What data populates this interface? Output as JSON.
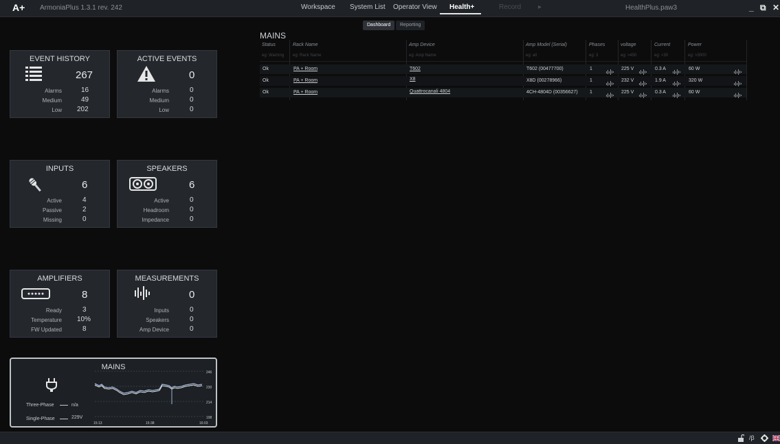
{
  "titlebar": {
    "logo": "A+",
    "app_version": "ArmoniaPlus 1.3.1 rev. 242",
    "menu": [
      "Workspace",
      "System List",
      "Operator View",
      "Health+",
      "Record"
    ],
    "file": "HealthPlus.paw3",
    "window_buttons": [
      "_",
      "⧉",
      "✕"
    ]
  },
  "subtabs": {
    "dashboard": "Dashboard",
    "reporting": "Reporting"
  },
  "cards": {
    "event_history": {
      "title": "EVENT HISTORY",
      "value": "267",
      "icon": "list-icon",
      "rows": [
        {
          "label": "Alarms",
          "value": "16"
        },
        {
          "label": "Medium",
          "value": "49"
        },
        {
          "label": "Low",
          "value": "202"
        }
      ]
    },
    "active_events": {
      "title": "ACTIVE EVENTS",
      "value": "0",
      "icon": "warning-icon",
      "rows": [
        {
          "label": "Alarms",
          "value": "0"
        },
        {
          "label": "Medium",
          "value": "0"
        },
        {
          "label": "Low",
          "value": "0"
        }
      ]
    },
    "inputs": {
      "title": "INPUTS",
      "value": "6",
      "icon": "microphone-icon",
      "rows": [
        {
          "label": "Active",
          "value": "4"
        },
        {
          "label": "Passive",
          "value": "2"
        },
        {
          "label": "Missing",
          "value": "0"
        }
      ]
    },
    "speakers": {
      "title": "SPEAKERS",
      "value": "6",
      "icon": "speaker-icon",
      "rows": [
        {
          "label": "Active",
          "value": "0"
        },
        {
          "label": "Headroom",
          "value": "0"
        },
        {
          "label": "Impedance",
          "value": "0"
        }
      ]
    },
    "amplifiers": {
      "title": "AMPLIFIERS",
      "value": "8",
      "icon": "amplifier-icon",
      "rows": [
        {
          "label": "Ready",
          "value": "3"
        },
        {
          "label": "Temperature",
          "value": "10%"
        },
        {
          "label": "FW Updated",
          "value": "8"
        }
      ]
    },
    "measurements": {
      "title": "MEASUREMENTS",
      "value": "0",
      "icon": "waveform-icon",
      "rows": [
        {
          "label": "Inputs",
          "value": "0"
        },
        {
          "label": "Speakers",
          "value": "0"
        },
        {
          "label": "Amp Device",
          "value": "0"
        }
      ]
    }
  },
  "mains_card": {
    "title": "MAINS",
    "icon": "power-plug-icon",
    "three_phase_label": "Three-Phase",
    "three_phase_value": "n/a",
    "single_phase_label": "Single-Phase",
    "single_phase_value": "229V",
    "y_ticks": [
      "246",
      "230",
      "214",
      "198"
    ],
    "x_ticks": [
      "15:13",
      "15:38",
      "16:03"
    ]
  },
  "mains_table": {
    "heading": "MAINS",
    "columns": [
      "Status",
      "Rack Name",
      "Amp Device",
      "Amp Model (Serial)",
      "Phases",
      "voltage",
      "Current",
      "Power"
    ],
    "placeholders": [
      "eg: Warning",
      "eg: Rack Name",
      "eg: Amp Name",
      "eg: all",
      "eg: 3",
      "eg: >450",
      "eg: <30",
      "eg: >3000"
    ],
    "rows": [
      {
        "status": "Ok",
        "rack": "PA + Room",
        "device": "T602",
        "model": "T602 (00477700)",
        "phases": "1",
        "voltage": "225 V",
        "current": "0.3 A",
        "power": "60 W"
      },
      {
        "status": "Ok",
        "rack": "PA + Room",
        "device": "X8",
        "model": "X8D (00278966)",
        "phases": "1",
        "voltage": "232 V",
        "current": "1.9 A",
        "power": "320 W"
      },
      {
        "status": "Ok",
        "rack": "PA + Room",
        "device": "Quattrocanali 4804",
        "model": "4CH-4804D (00356627)",
        "phases": "1",
        "voltage": "225 V",
        "current": "0.3 A",
        "power": "60 W"
      }
    ]
  },
  "statusbar": {
    "icons": [
      "unlock-icon",
      "beta-icon",
      "gear-icon",
      "flag-icon"
    ],
    "beta_label": "/β"
  }
}
